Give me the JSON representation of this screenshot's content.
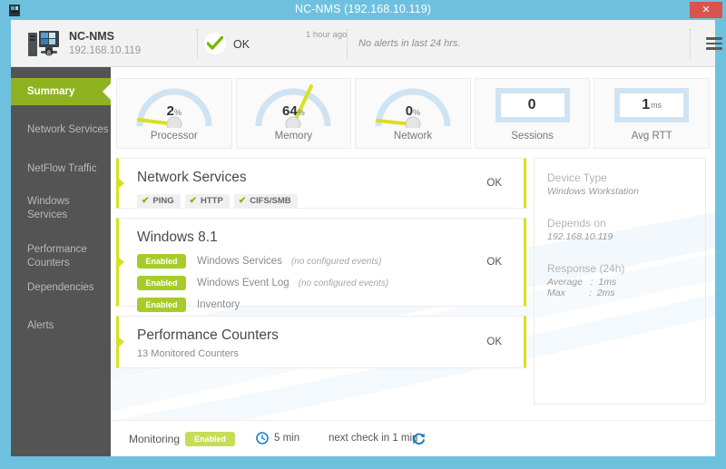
{
  "titlebar": {
    "title": "NC-NMS (192.168.10.119)",
    "icon": "device-icon",
    "close_label": "✕"
  },
  "header": {
    "device_name": "NC-NMS",
    "device_ip": "192.168.10.119",
    "status": "OK",
    "status_icon": "green-check-icon",
    "last_checked": "1 hour ago",
    "alerts_text": "No alerts in last 24 hrs.",
    "menu_icon": "hamburger-menu-icon"
  },
  "sidebar": {
    "items": [
      {
        "label": "Summary",
        "active": true
      },
      {
        "label": "Network Services",
        "active": false
      },
      {
        "label": "NetFlow Traffic",
        "active": false
      },
      {
        "label": "Windows Services",
        "active": false
      },
      {
        "label": "Performance Counters",
        "active": false
      },
      {
        "label": "Dependencies",
        "active": false
      },
      {
        "label": "Alerts",
        "active": false
      }
    ]
  },
  "gauges": [
    {
      "label": "Processor",
      "value": "2",
      "unit": "%",
      "type": "gauge",
      "percent": 2
    },
    {
      "label": "Memory",
      "value": "64",
      "unit": "%",
      "type": "gauge",
      "percent": 64
    },
    {
      "label": "Network",
      "value": "0",
      "unit": "%",
      "type": "gauge",
      "percent": 0
    },
    {
      "label": "Sessions",
      "value": "0",
      "unit": "",
      "type": "box"
    },
    {
      "label": "Avg RTT",
      "value": "1",
      "unit": "ms",
      "type": "box"
    }
  ],
  "cards": {
    "network_services": {
      "title": "Network Services",
      "status": "OK",
      "badges": [
        {
          "label": "PING",
          "icon": "check-icon"
        },
        {
          "label": "HTTP",
          "icon": "check-icon"
        },
        {
          "label": "CIFS/SMB",
          "icon": "check-icon"
        }
      ]
    },
    "windows": {
      "title": "Windows 8.1",
      "status": "OK",
      "rows": [
        {
          "chip": "Enabled",
          "name": "Windows Services",
          "note": "(no configured events)"
        },
        {
          "chip": "Enabled",
          "name": "Windows Event Log",
          "note": "(no configured events)"
        },
        {
          "chip": "Enabled",
          "name": "Inventory",
          "note": ""
        }
      ]
    },
    "performance": {
      "title": "Performance Counters",
      "status": "OK",
      "subtitle": "13 Monitored Counters"
    }
  },
  "info_panel": {
    "device_type_label": "Device Type",
    "device_type_value": "Windows Workstation",
    "depends_on_label": "Depends on",
    "depends_on_value": "192.168.10.119",
    "response_label": "Response (24h)",
    "response_average": "Average   :  1ms",
    "response_max": "Max         :  2ms"
  },
  "footer": {
    "monitoring_label": "Monitoring",
    "monitoring_state": "Enabled",
    "clock_icon": "clock-icon",
    "interval": "5 min",
    "next_check": "next check in 1 min",
    "refresh_icon": "refresh-icon"
  },
  "colors": {
    "window_frame": "#6ec1de",
    "accent_green": "#8fb320",
    "card_accent": "#d9e021",
    "chip_green": "#a7cc2a",
    "gauge_arc": "#cfe3f3",
    "gauge_needle": "#d9e021",
    "close_red": "#d9534f"
  }
}
